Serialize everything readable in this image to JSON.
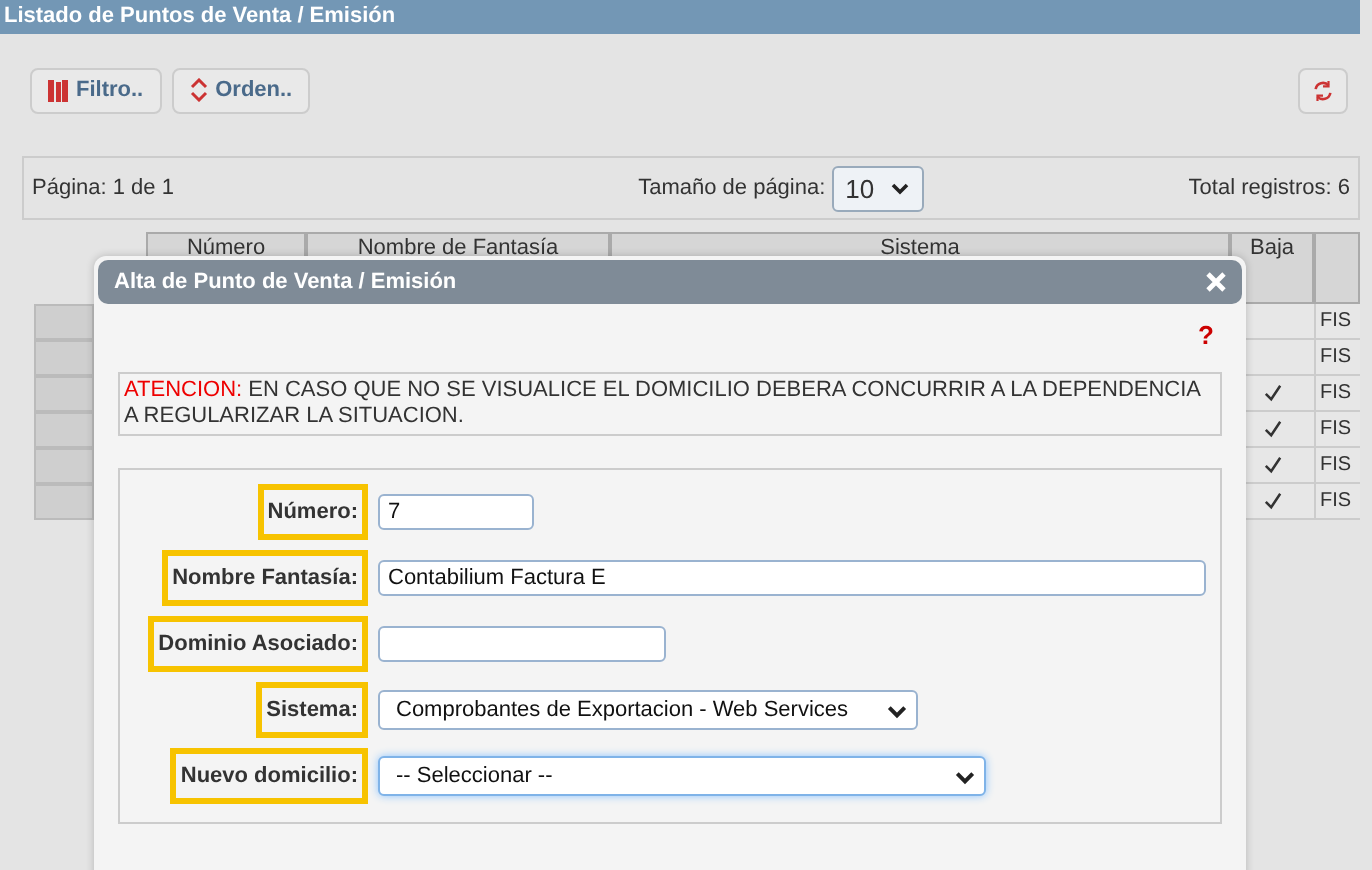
{
  "page_title": "Listado de Puntos de Venta / Emisión",
  "toolbar": {
    "buttons": [
      {
        "kind": "filter",
        "label": "Filtro.."
      },
      {
        "kind": "order",
        "label": "Orden.."
      }
    ]
  },
  "pager": {
    "page": "Página: 1 de 1",
    "page_size_label": "Tamaño de página:",
    "page_size": "10",
    "total": "Total registros: 6"
  },
  "table": {
    "columns": [
      "Número",
      "Nombre de Fantasía",
      "Sistema",
      "Baja"
    ],
    "rows": [
      {
        "baja": false,
        "column_6": "FIS"
      },
      {
        "baja": false,
        "column_6": "FIS"
      },
      {
        "baja": true,
        "column_6": "FIS"
      },
      {
        "baja": true,
        "column_6": "FIS"
      },
      {
        "baja": true,
        "column_6": "FIS"
      },
      {
        "baja": true,
        "column_6": "FIS"
      }
    ]
  },
  "dialog": {
    "title": "Alta de Punto de Venta / Emisión",
    "help": "?",
    "warning_label": "ATENCION:",
    "warning": "EN CASO QUE NO SE VISUALICE EL DOMICILIO DEBERA CONCURRIR A LA DEPENDENCIA A REGULARIZAR LA SITUACION.",
    "fields": [
      {
        "kind": "text",
        "label": "Número:",
        "value": "7",
        "highlighted": true
      },
      {
        "kind": "text",
        "label": "Nombre Fantasía:",
        "value": "Contabilium Factura E",
        "highlighted": true
      },
      {
        "kind": "text",
        "label": "Dominio Asociado:",
        "highlighted": true
      },
      {
        "kind": "select",
        "label": "Sistema:",
        "value": "Comprobantes de Exportacion - Web Services",
        "highlighted": true,
        "focused": false
      },
      {
        "kind": "select",
        "label": "Nuevo domicilio:",
        "value": "-- Seleccionar --",
        "highlighted": true,
        "focused": true
      }
    ]
  }
}
